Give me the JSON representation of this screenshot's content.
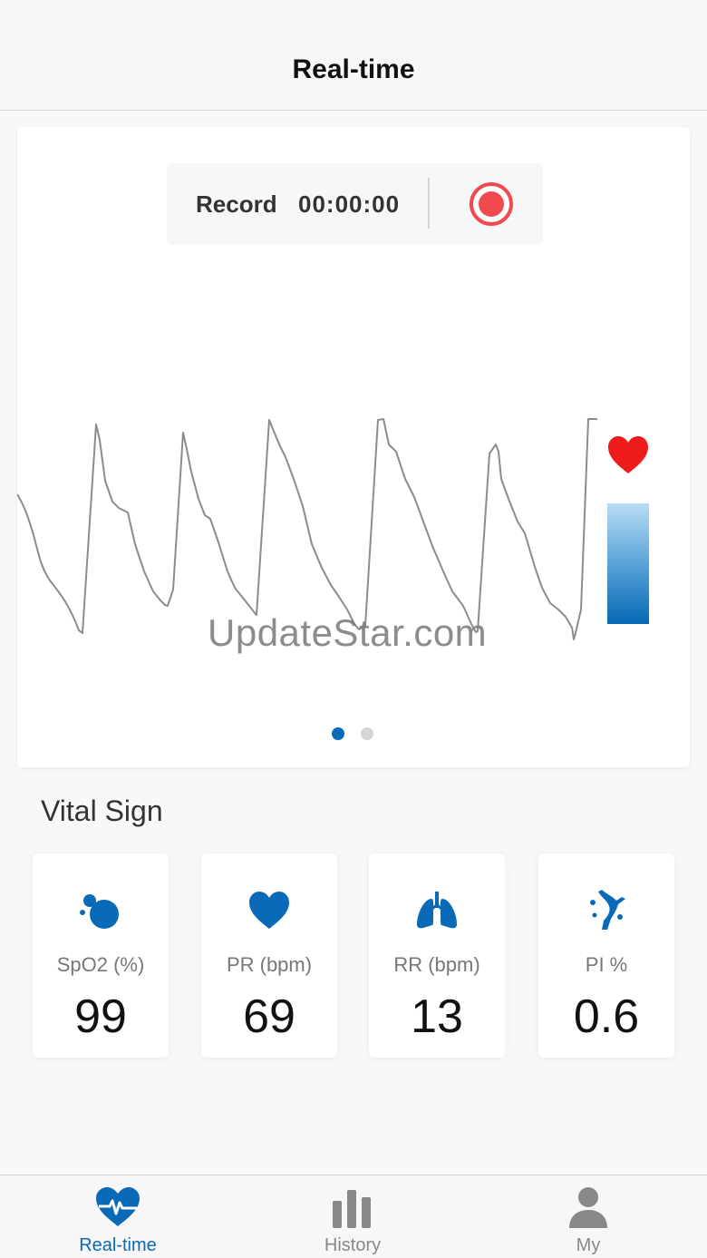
{
  "header": {
    "title": "Real-time"
  },
  "record": {
    "label": "Record",
    "time": "00:00:00"
  },
  "watermark": "UpdateStar.com",
  "section_title": "Vital Sign",
  "vitals": [
    {
      "label": "SpO2 (%)",
      "value": "99",
      "icon": "oxygen-icon"
    },
    {
      "label": "PR (bpm)",
      "value": "69",
      "icon": "heart-icon"
    },
    {
      "label": "RR (bpm)",
      "value": "13",
      "icon": "lungs-icon"
    },
    {
      "label": "PI %",
      "value": "0.6",
      "icon": "perfusion-icon"
    }
  ],
  "pager": {
    "pages": 2,
    "active": 0
  },
  "tabs": [
    {
      "label": "Real-time",
      "icon": "heart-monitor-icon",
      "active": true
    },
    {
      "label": "History",
      "icon": "bar-chart-icon",
      "active": false
    },
    {
      "label": "My",
      "icon": "person-icon",
      "active": false
    }
  ],
  "colors": {
    "accent": "#0a6ab8",
    "record_red": "#f04a4f",
    "heart_red": "#ee1b1b",
    "waveform": "#8c8c8c"
  }
}
